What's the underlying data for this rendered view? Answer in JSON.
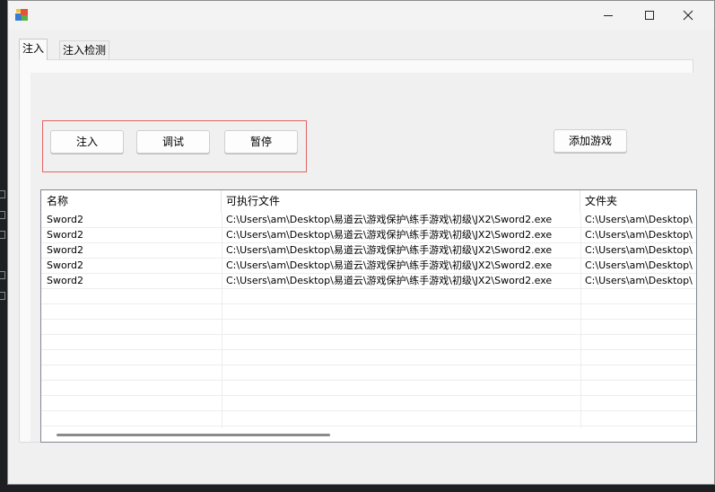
{
  "window": {
    "colors": {
      "accent": "#e06464",
      "title_bg": "#f3f3f3",
      "body_bg": "#f0f0f0"
    },
    "icons": {
      "app": "app-icon",
      "minimize": "minimize-icon",
      "maximize": "maximize-icon",
      "close": "close-icon"
    }
  },
  "tabs": [
    {
      "label": "注入"
    },
    {
      "label": "注入检测"
    }
  ],
  "actions": {
    "inject_label": "注入",
    "debug_label": "调试",
    "pause_label": "暂停",
    "add_game_label": "添加游戏"
  },
  "table": {
    "columns": [
      "名称",
      "可执行文件",
      "文件夹"
    ],
    "rows": [
      [
        "Sword2",
        "C:\\Users\\am\\Desktop\\易道云\\游戏保护\\练手游戏\\初级\\JX2\\Sword2.exe",
        "C:\\Users\\am\\Desktop\\"
      ],
      [
        "Sword2",
        "C:\\Users\\am\\Desktop\\易道云\\游戏保护\\练手游戏\\初级\\JX2\\Sword2.exe",
        "C:\\Users\\am\\Desktop\\"
      ],
      [
        "Sword2",
        "C:\\Users\\am\\Desktop\\易道云\\游戏保护\\练手游戏\\初级\\JX2\\Sword2.exe",
        "C:\\Users\\am\\Desktop\\"
      ],
      [
        "Sword2",
        "C:\\Users\\am\\Desktop\\易道云\\游戏保护\\练手游戏\\初级\\JX2\\Sword2.exe",
        "C:\\Users\\am\\Desktop\\"
      ],
      [
        "Sword2",
        "C:\\Users\\am\\Desktop\\易道云\\游戏保护\\练手游戏\\初级\\JX2\\Sword2.exe",
        "C:\\Users\\am\\Desktop\\"
      ]
    ]
  }
}
